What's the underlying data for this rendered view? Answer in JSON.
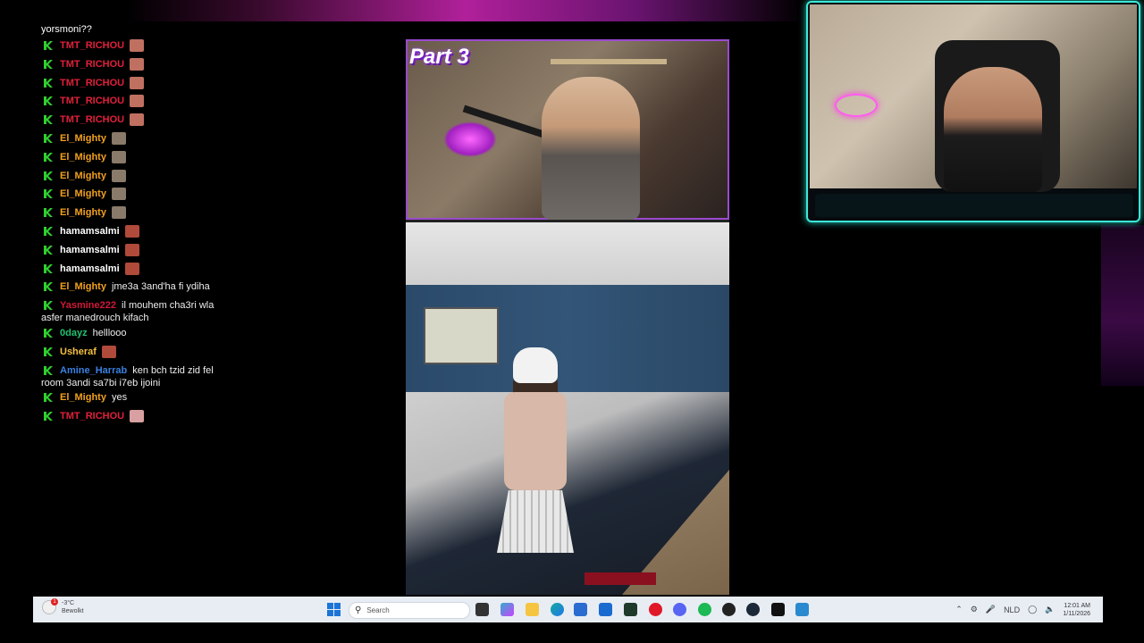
{
  "chat": {
    "first_line": "yorsmoni??",
    "messages": [
      {
        "user": "TMT_RICHOU",
        "color": "#e0203a",
        "text": "",
        "emote": "#c07060"
      },
      {
        "user": "TMT_RICHOU",
        "color": "#e0203a",
        "text": "",
        "emote": "#c07060"
      },
      {
        "user": "TMT_RICHOU",
        "color": "#e0203a",
        "text": "",
        "emote": "#c07060"
      },
      {
        "user": "TMT_RICHOU",
        "color": "#e0203a",
        "text": "",
        "emote": "#c07060"
      },
      {
        "user": "TMT_RICHOU",
        "color": "#e0203a",
        "text": "",
        "emote": "#c07060"
      },
      {
        "user": "El_Mighty",
        "color": "#f0a020",
        "text": "",
        "emote": "#8a7a6a"
      },
      {
        "user": "El_Mighty",
        "color": "#f0a020",
        "text": "",
        "emote": "#8a7a6a"
      },
      {
        "user": "El_Mighty",
        "color": "#f0a020",
        "text": "",
        "emote": "#8a7a6a"
      },
      {
        "user": "El_Mighty",
        "color": "#f0a020",
        "text": "",
        "emote": "#8a7a6a"
      },
      {
        "user": "El_Mighty",
        "color": "#f0a020",
        "text": "",
        "emote": "#8a7a6a"
      },
      {
        "user": "hamamsalmi",
        "color": "#ffffff",
        "text": "",
        "emote": "#b04a3a"
      },
      {
        "user": "hamamsalmi",
        "color": "#ffffff",
        "text": "",
        "emote": "#b04a3a"
      },
      {
        "user": "hamamsalmi",
        "color": "#ffffff",
        "text": "",
        "emote": "#b04a3a"
      },
      {
        "user": "El_Mighty",
        "color": "#f0a020",
        "text": "jme3a 3and'ha fi ydiha",
        "emote": ""
      },
      {
        "user": "Yasmine222",
        "color": "#d01838",
        "text": "il mouhem cha3ri wla",
        "cont": "asfer manedrouch kifach",
        "emote": ""
      },
      {
        "user": "0dayz",
        "color": "#20c070",
        "text": "helllooo",
        "emote": ""
      },
      {
        "user": "Usheraf",
        "color": "#f4c040",
        "text": "",
        "emote": "#b04a3a"
      },
      {
        "user": "Amine_Harrab",
        "color": "#3a80e0",
        "text": "ken bch tzid zid fel",
        "cont": "room 3andi sa7bi i7eb ijoini",
        "emote": ""
      },
      {
        "user": "El_Mighty",
        "color": "#f0a020",
        "text": "yes",
        "emote": ""
      },
      {
        "user": "TMT_RICHOU",
        "color": "#e0203a",
        "text": "",
        "emote": "#d8a0a0"
      }
    ]
  },
  "video": {
    "overlay_label": "Part 3"
  },
  "taskbar": {
    "weather_temp": "-3°C",
    "weather_desc": "Bewolkt",
    "weather_badge": "1",
    "search_placeholder": "Search",
    "language": "NLD",
    "time": "12:01 AM",
    "date": "1/11/2026"
  },
  "colors": {
    "badge_green": "#2fd02f",
    "facecam_border": "#3ee8d8",
    "video_border": "#9a4ad0"
  }
}
